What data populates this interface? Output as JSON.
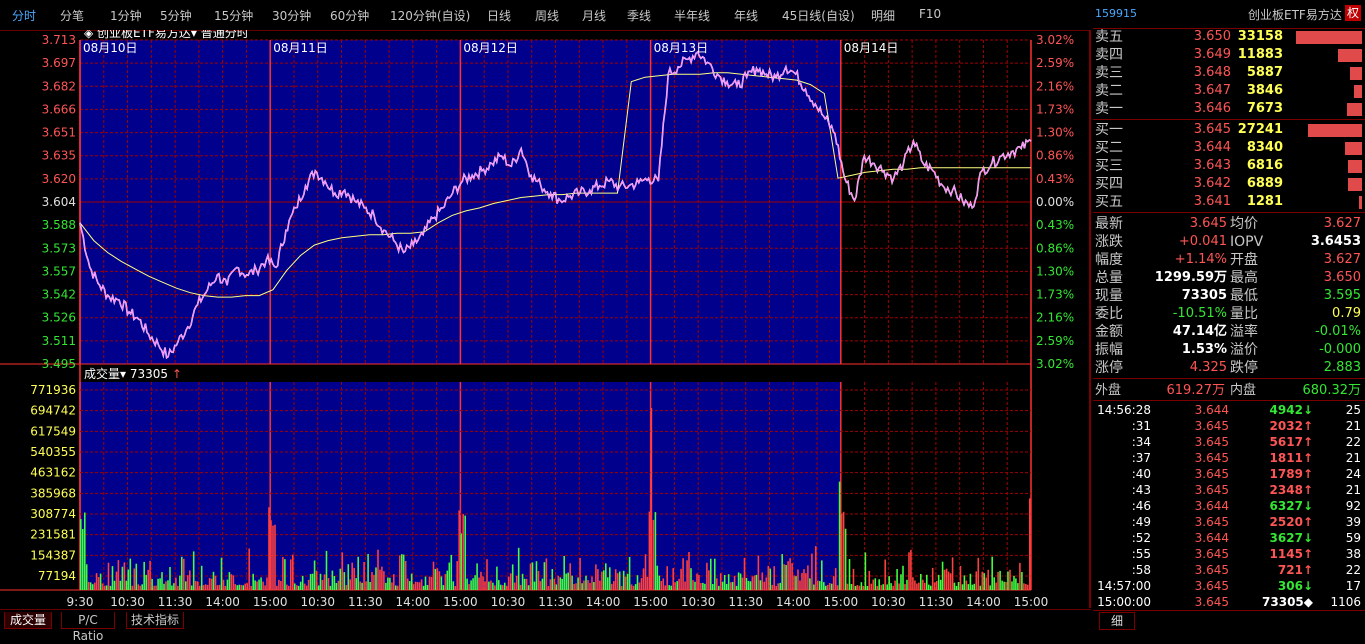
{
  "toolbar": {
    "tabs": [
      "分时",
      "分笔",
      "1分钟",
      "5分钟",
      "15分钟",
      "30分钟",
      "60分钟",
      "120分钟(自设)",
      "日线",
      "周线",
      "月线",
      "季线",
      "半年线",
      "年线",
      "45日线(自设)",
      "明细",
      "F10"
    ],
    "active": 0
  },
  "chart": {
    "title": "创业板ETF易方达",
    "mode": "普通分时",
    "dates": [
      "08月10日",
      "08月11日",
      "08月12日",
      "08月13日",
      "08月14日"
    ],
    "price_labels": [
      "3.713",
      "3.697",
      "3.682",
      "3.666",
      "3.651",
      "3.635",
      "3.620",
      "3.604",
      "3.588",
      "3.573",
      "3.557",
      "3.542",
      "3.526",
      "3.511",
      "3.495"
    ],
    "pct_labels": [
      "3.02%",
      "2.59%",
      "2.16%",
      "1.73%",
      "1.30%",
      "0.86%",
      "0.43%",
      "0.00%",
      "0.43%",
      "0.86%",
      "1.30%",
      "1.73%",
      "2.16%",
      "2.59%",
      "3.02%"
    ],
    "vol_label": "成交量",
    "vol_value": "73305",
    "vol_arrow": "↑",
    "vol_labels": [
      "771936",
      "694742",
      "617549",
      "540355",
      "463162",
      "385968",
      "308774",
      "231581",
      "154387",
      "77194"
    ],
    "time_labels": [
      "9:30",
      "10:30",
      "11:30",
      "14:00",
      "15:00",
      "10:30",
      "11:30",
      "14:00",
      "15:00",
      "10:30",
      "11:30",
      "14:00",
      "15:00",
      "10:30",
      "11:30",
      "14:00",
      "15:00",
      "10:30",
      "11:30",
      "14:00",
      "15:00"
    ],
    "colors": {
      "bg_blue": "#00008c",
      "grid": "#a00000",
      "price_line": "#ff80ff",
      "avg_line": "#ffff80",
      "up": "#ff4040",
      "down": "#40ff40",
      "white_line": "#ffffff"
    }
  },
  "chart_data": {
    "type": "line",
    "title": "创业板ETF易方达",
    "xlabel": "",
    "ylabel": "",
    "ylim": [
      3.495,
      3.713
    ],
    "prev_close": 3.604,
    "days": [
      "08月10日",
      "08月11日",
      "08月12日",
      "08月13日",
      "08月14日"
    ],
    "series": [
      {
        "values": [
          3.59,
          3.56,
          3.548,
          3.54,
          3.538,
          3.53,
          3.525,
          3.515,
          3.508,
          3.5,
          3.51,
          3.52,
          3.535,
          3.545,
          3.555,
          3.548,
          3.56,
          3.555,
          3.558,
          3.565,
          3.56,
          3.585,
          3.6,
          3.615,
          3.625,
          3.618,
          3.61,
          3.612,
          3.605,
          3.6,
          3.595,
          3.585,
          3.578,
          3.57,
          3.575,
          3.582,
          3.593,
          3.6,
          3.61,
          3.618,
          3.622,
          3.625,
          3.63,
          3.635,
          3.628,
          3.64,
          3.622,
          3.615,
          3.61,
          3.605,
          3.608,
          3.61,
          3.612,
          3.615,
          3.618,
          3.614,
          3.615,
          3.617,
          3.62,
          3.618,
          3.69,
          3.695,
          3.7,
          3.705,
          3.698,
          3.69,
          3.685,
          3.682,
          3.688,
          3.694,
          3.69,
          3.688,
          3.695,
          3.69,
          3.68,
          3.67,
          3.66,
          3.65,
          3.62,
          3.605,
          3.635,
          3.63,
          3.625,
          3.62,
          3.63,
          3.645,
          3.63,
          3.625,
          3.615,
          3.612,
          3.605,
          3.6,
          3.625,
          3.63,
          3.635,
          3.638,
          3.64,
          3.645
        ]
      },
      {
        "values": [
          3.59,
          3.578,
          3.57,
          3.564,
          3.559,
          3.554,
          3.55,
          3.546,
          3.543,
          3.541,
          3.54,
          3.54,
          3.541,
          3.541,
          3.545,
          3.558,
          3.568,
          3.575,
          3.578,
          3.58,
          3.581,
          3.582,
          3.582,
          3.583,
          3.583,
          3.584,
          3.59,
          3.595,
          3.598,
          3.6,
          3.603,
          3.605,
          3.607,
          3.608,
          3.609,
          3.609,
          3.61,
          3.61,
          3.61,
          3.61,
          3.685,
          3.688,
          3.689,
          3.69,
          3.69,
          3.69,
          3.691,
          3.691,
          3.69,
          3.689,
          3.688,
          3.687,
          3.686,
          3.683,
          3.677,
          3.62,
          3.622,
          3.624,
          3.625,
          3.626,
          3.626,
          3.627,
          3.627,
          3.627,
          3.627,
          3.627,
          3.627,
          3.627,
          3.627,
          3.627
        ]
      }
    ]
  },
  "panel": {
    "code": "159915",
    "name": "创业板ETF易方达",
    "quan": "权",
    "asks": [
      {
        "label": "卖五",
        "price": "3.650",
        "vol": "33158",
        "frac": 1.0
      },
      {
        "label": "卖四",
        "price": "3.649",
        "vol": "11883",
        "frac": 0.36
      },
      {
        "label": "卖三",
        "price": "3.648",
        "vol": "5887",
        "frac": 0.18
      },
      {
        "label": "卖二",
        "price": "3.647",
        "vol": "3846",
        "frac": 0.12
      },
      {
        "label": "卖一",
        "price": "3.646",
        "vol": "7673",
        "frac": 0.23
      }
    ],
    "bids": [
      {
        "label": "买一",
        "price": "3.645",
        "vol": "27241",
        "frac": 0.82
      },
      {
        "label": "买二",
        "price": "3.644",
        "vol": "8340",
        "frac": 0.25
      },
      {
        "label": "买三",
        "price": "3.643",
        "vol": "6816",
        "frac": 0.21
      },
      {
        "label": "买四",
        "price": "3.642",
        "vol": "6889",
        "frac": 0.21
      },
      {
        "label": "买五",
        "price": "3.641",
        "vol": "1281",
        "frac": 0.04
      }
    ],
    "stats": [
      {
        "l1": "最新",
        "v1": "3.645",
        "c1": "red",
        "l2": "均价",
        "v2": "3.627",
        "c2": "red"
      },
      {
        "l1": "涨跌",
        "v1": "+0.041",
        "c1": "red",
        "l2": "IOPV",
        "v2": "3.6453",
        "c2": "wht"
      },
      {
        "l1": "幅度",
        "v1": "+1.14%",
        "c1": "red",
        "l2": "开盘",
        "v2": "3.627",
        "c2": "red"
      },
      {
        "l1": "总量",
        "v1": "1299.59万",
        "c1": "wht",
        "l2": "最高",
        "v2": "3.650",
        "c2": "red"
      },
      {
        "l1": "现量",
        "v1": "73305",
        "c1": "wht",
        "l2": "最低",
        "v2": "3.595",
        "c2": "grn"
      },
      {
        "l1": "委比",
        "v1": "-10.51%",
        "c1": "grn",
        "l2": "量比",
        "v2": "0.79",
        "c2": "yel"
      },
      {
        "l1": "金额",
        "v1": "47.14亿",
        "c1": "wht",
        "l2": "溢率",
        "v2": "-0.01%",
        "c2": "grn"
      },
      {
        "l1": "振幅",
        "v1": "1.53%",
        "c1": "wht",
        "l2": "溢价",
        "v2": "-0.000",
        "c2": "grn"
      },
      {
        "l1": "涨停",
        "v1": "4.325",
        "c1": "red",
        "l2": "跌停",
        "v2": "2.883",
        "c2": "grn"
      }
    ],
    "outer_label": "外盘",
    "outer_value": "619.27万",
    "inner_label": "内盘",
    "inner_value": "680.32万",
    "ticks": [
      {
        "time": "14:56:28",
        "price": "3.644",
        "pc": "red",
        "vol": "4942",
        "arrow": "↓",
        "ac": "grn",
        "n": "25"
      },
      {
        "time": ":31",
        "price": "3.645",
        "pc": "red",
        "vol": "2032",
        "arrow": "↑",
        "ac": "red",
        "n": "21"
      },
      {
        "time": ":34",
        "price": "3.645",
        "pc": "red",
        "vol": "5617",
        "arrow": "↑",
        "ac": "red",
        "n": "22"
      },
      {
        "time": ":37",
        "price": "3.645",
        "pc": "red",
        "vol": "1811",
        "arrow": "↑",
        "ac": "red",
        "n": "21"
      },
      {
        "time": ":40",
        "price": "3.645",
        "pc": "red",
        "vol": "1789",
        "arrow": "↑",
        "ac": "red",
        "n": "24"
      },
      {
        "time": ":43",
        "price": "3.645",
        "pc": "red",
        "vol": "2348",
        "arrow": "↑",
        "ac": "red",
        "n": "21"
      },
      {
        "time": ":46",
        "price": "3.644",
        "pc": "red",
        "vol": "6327",
        "arrow": "↓",
        "ac": "grn",
        "n": "92"
      },
      {
        "time": ":49",
        "price": "3.645",
        "pc": "red",
        "vol": "2520",
        "arrow": "↑",
        "ac": "red",
        "n": "39"
      },
      {
        "time": ":52",
        "price": "3.644",
        "pc": "red",
        "vol": "3627",
        "arrow": "↓",
        "ac": "grn",
        "n": "59"
      },
      {
        "time": ":55",
        "price": "3.645",
        "pc": "red",
        "vol": "1145",
        "arrow": "↑",
        "ac": "red",
        "n": "38"
      },
      {
        "time": ":58",
        "price": "3.645",
        "pc": "red",
        "vol": "721",
        "arrow": "↑",
        "ac": "red",
        "n": "22"
      },
      {
        "time": "14:57:00",
        "price": "3.645",
        "pc": "red",
        "vol": "306",
        "arrow": "↓",
        "ac": "grn",
        "n": "17"
      },
      {
        "time": "15:00:00",
        "price": "3.645",
        "pc": "red",
        "vol": "73305",
        "arrow": "◆",
        "ac": "wht",
        "n": "1106"
      }
    ],
    "footer_tab": "细"
  },
  "bottom_tabs": [
    "成交量",
    "P/C Ratio",
    "技术指标"
  ]
}
